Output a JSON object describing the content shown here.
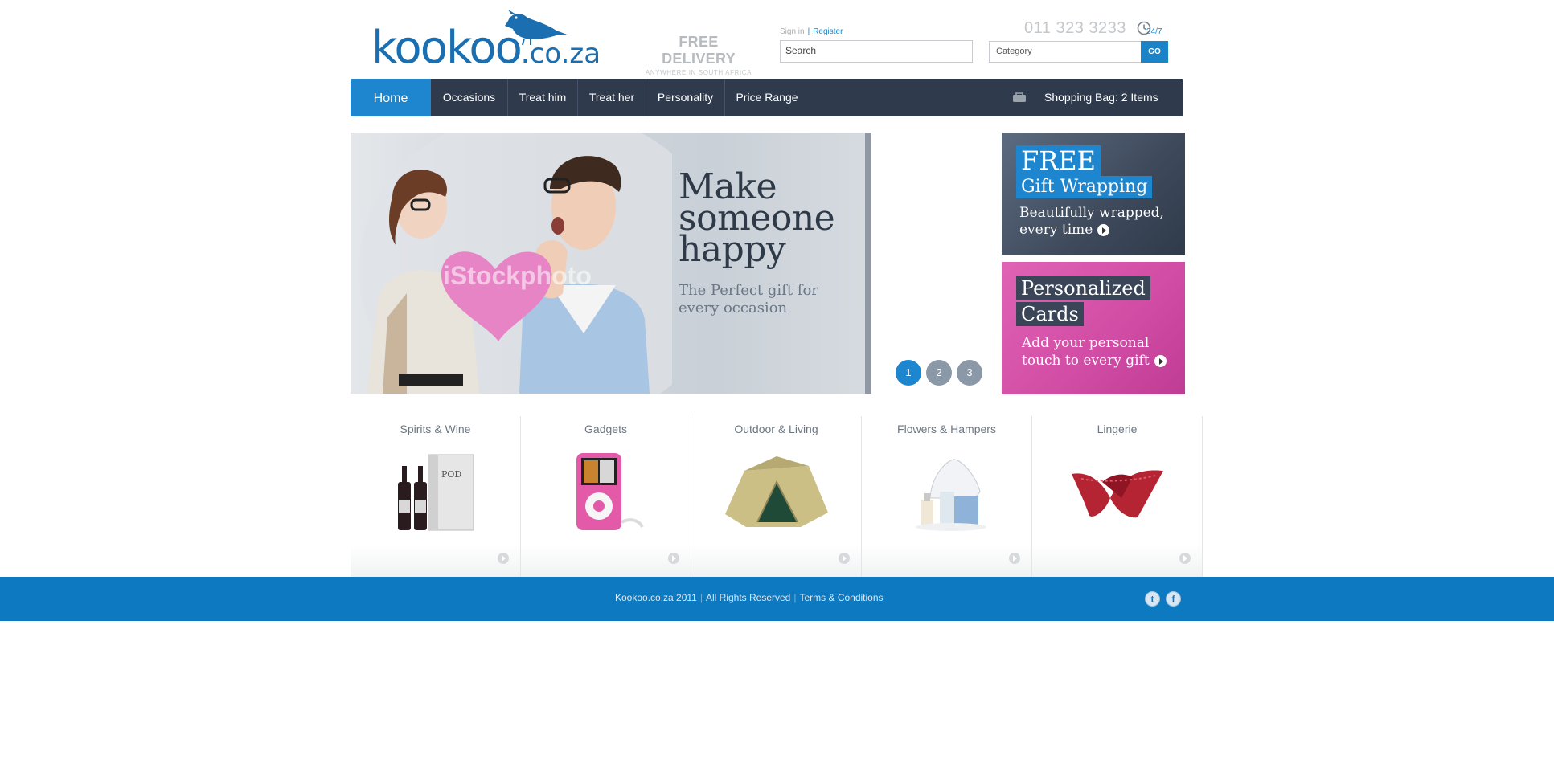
{
  "header": {
    "logo_main": "kookoo",
    "logo_tld": ".co.za",
    "delivery_title": "FREE DELIVERY",
    "delivery_sub": "ANYWHERE IN SOUTH AFRICA",
    "signin_label": "Sign in",
    "register_label": "Register",
    "search_value": "Search",
    "phone": "011 323 3233",
    "support_hours": "24/7",
    "category_value": "Category",
    "go_label": "GO"
  },
  "nav": {
    "home": "Home",
    "items": [
      "Occasions",
      "Treat him",
      "Treat her",
      "Personality",
      "Price Range"
    ],
    "bag": "Shopping Bag: 2 Items"
  },
  "hero": {
    "headline": "Make\nsomeone\nhappy",
    "subline": "The Perfect gift for\nevery occasion",
    "watermark": "iStockphoto",
    "slides": [
      "1",
      "2",
      "3"
    ],
    "active_slide": 1
  },
  "promos": {
    "gift": {
      "tag1": "FREE",
      "tag2": "Gift Wrapping",
      "text": "Beautifully wrapped,\nevery time"
    },
    "cards": {
      "tag1": "Personalized",
      "tag2": "Cards",
      "text": "Add your personal\ntouch to every gift"
    }
  },
  "categories": [
    "Spirits & Wine",
    "Gadgets",
    "Outdoor & Living",
    "Flowers & Hampers",
    "Lingerie"
  ],
  "footer": {
    "copyright": "Kookoo.co.za 2011",
    "rights": "All Rights Reserved",
    "terms": "Terms & Conditions",
    "social": [
      "twitter-icon",
      "facebook-icon"
    ]
  },
  "colors": {
    "brand_blue": "#1e86cf",
    "nav_dark": "#2f3b4d",
    "footer_blue": "#0c79c1",
    "promo_pink": "#d14ca4"
  }
}
